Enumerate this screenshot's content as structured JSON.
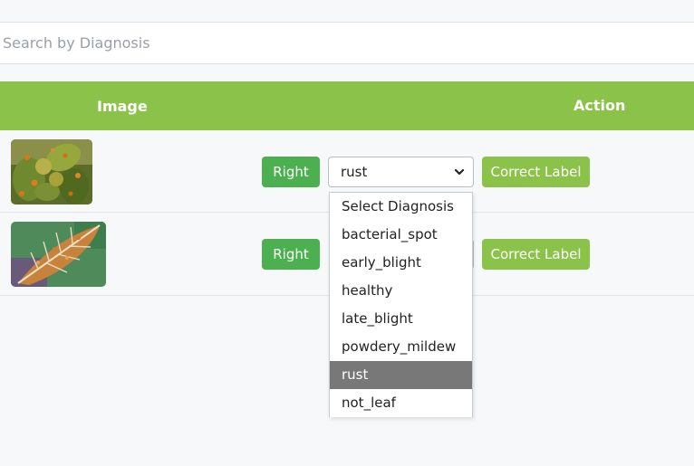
{
  "search": {
    "placeholder": "Search by Diagnosis",
    "value": ""
  },
  "table": {
    "headers": {
      "image": "Image",
      "action": "Action"
    },
    "rows": [
      {
        "image_icon": "pear-leaf-rust-photo",
        "right_label": "Right",
        "selected_diagnosis": "rust",
        "correct_label": "Correct Label"
      },
      {
        "image_icon": "leaf-rust-photo",
        "right_label": "Right",
        "correct_label": "Correct Label"
      }
    ]
  },
  "dropdown": {
    "options": [
      "Select Diagnosis",
      "bacterial_spot",
      "early_blight",
      "healthy",
      "late_blight",
      "powdery_mildew",
      "rust",
      "not_leaf"
    ],
    "selected": "rust"
  },
  "colors": {
    "header_bg": "#8bc34a",
    "right_button": "#4caf50",
    "correct_button": "#8bc34a",
    "option_highlight": "#787878"
  }
}
